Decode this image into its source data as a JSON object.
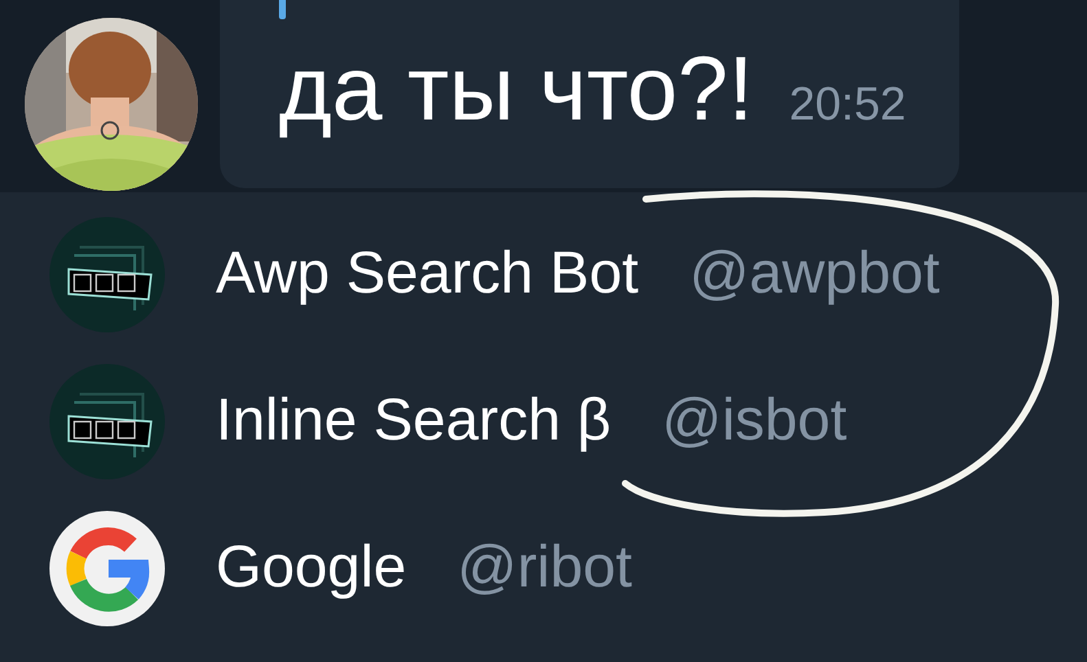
{
  "message": {
    "text": "да ты что?!",
    "time": "20:52",
    "has_reply_quote": true
  },
  "suggestions": [
    {
      "kind": "bot",
      "name": "Awp Search Bot",
      "username": "@awpbot"
    },
    {
      "kind": "bot",
      "name": "Inline Search β",
      "username": "@isbot"
    },
    {
      "kind": "google",
      "name": "Google",
      "username": "@ribot"
    }
  ]
}
